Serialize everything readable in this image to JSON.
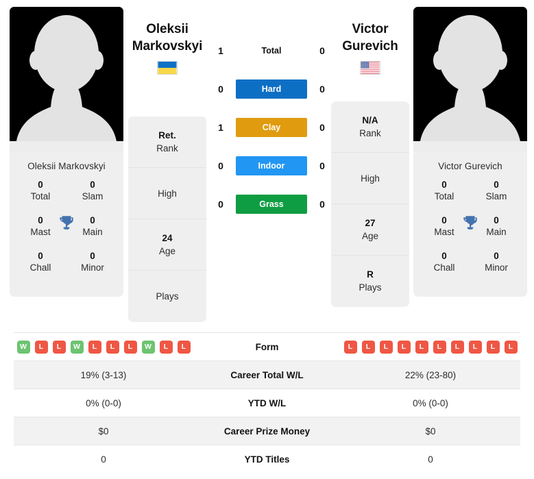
{
  "players": {
    "left": {
      "name_full": "Oleksii Markovskyi",
      "name_line1": "Oleksii",
      "name_line2": "Markovskyi",
      "country": "Ukraine",
      "flag": "ua-flag-icon",
      "titles": [
        {
          "value": "0",
          "label": "Total"
        },
        {
          "value": "0",
          "label": "Slam"
        },
        {
          "value": "0",
          "label": "Mast"
        },
        {
          "value": "0",
          "label": "Main"
        },
        {
          "value": "0",
          "label": "Chall"
        },
        {
          "value": "0",
          "label": "Minor"
        }
      ],
      "info": [
        {
          "value": "Ret.",
          "label": "Rank"
        },
        {
          "value": "",
          "label": "High"
        },
        {
          "value": "24",
          "label": "Age"
        },
        {
          "value": "",
          "label": "Plays"
        }
      ],
      "form": [
        "W",
        "L",
        "L",
        "W",
        "L",
        "L",
        "L",
        "W",
        "L",
        "L"
      ],
      "career_total_wl": "19% (3-13)",
      "ytd_wl": "0% (0-0)",
      "career_prize_money": "$0",
      "ytd_titles": "0"
    },
    "right": {
      "name_full": "Victor Gurevich",
      "name_line1": "Victor",
      "name_line2": "Gurevich",
      "country": "United States",
      "flag": "us-flag-icon",
      "titles": [
        {
          "value": "0",
          "label": "Total"
        },
        {
          "value": "0",
          "label": "Slam"
        },
        {
          "value": "0",
          "label": "Mast"
        },
        {
          "value": "0",
          "label": "Main"
        },
        {
          "value": "0",
          "label": "Chall"
        },
        {
          "value": "0",
          "label": "Minor"
        }
      ],
      "info": [
        {
          "value": "N/A",
          "label": "Rank"
        },
        {
          "value": "",
          "label": "High"
        },
        {
          "value": "27",
          "label": "Age"
        },
        {
          "value": "R",
          "label": "Plays"
        }
      ],
      "form": [
        "L",
        "L",
        "L",
        "L",
        "L",
        "L",
        "L",
        "L",
        "L",
        "L"
      ],
      "career_total_wl": "22% (23-80)",
      "ytd_wl": "0% (0-0)",
      "career_prize_money": "$0",
      "ytd_titles": "0"
    }
  },
  "head_to_head": [
    {
      "label": "Total",
      "left": "1",
      "right": "0",
      "color": "none",
      "plain": true
    },
    {
      "label": "Hard",
      "left": "0",
      "right": "0",
      "color": "#0d6fc4",
      "plain": false
    },
    {
      "label": "Clay",
      "left": "1",
      "right": "0",
      "color": "#e09b0f",
      "plain": false
    },
    {
      "label": "Indoor",
      "left": "0",
      "right": "0",
      "color": "#2196f3",
      "plain": false
    },
    {
      "label": "Grass",
      "left": "0",
      "right": "0",
      "color": "#0f9d43",
      "plain": false
    }
  ],
  "stats_rows": [
    {
      "label": "Form",
      "left": "",
      "right": "",
      "type": "form"
    },
    {
      "label": "Career Total W/L",
      "left": "19% (3-13)",
      "right": "22% (23-80)",
      "type": "text"
    },
    {
      "label": "YTD W/L",
      "left": "0% (0-0)",
      "right": "0% (0-0)",
      "type": "text"
    },
    {
      "label": "Career Prize Money",
      "left": "$0",
      "right": "$0",
      "type": "text"
    },
    {
      "label": "YTD Titles",
      "left": "0",
      "right": "0",
      "type": "text"
    }
  ],
  "colors": {
    "win": "#6cc470",
    "loss": "#ef5744",
    "trophy": "#4472b0",
    "card_bg": "#efefef",
    "row_stripe": "#f2f2f2"
  }
}
